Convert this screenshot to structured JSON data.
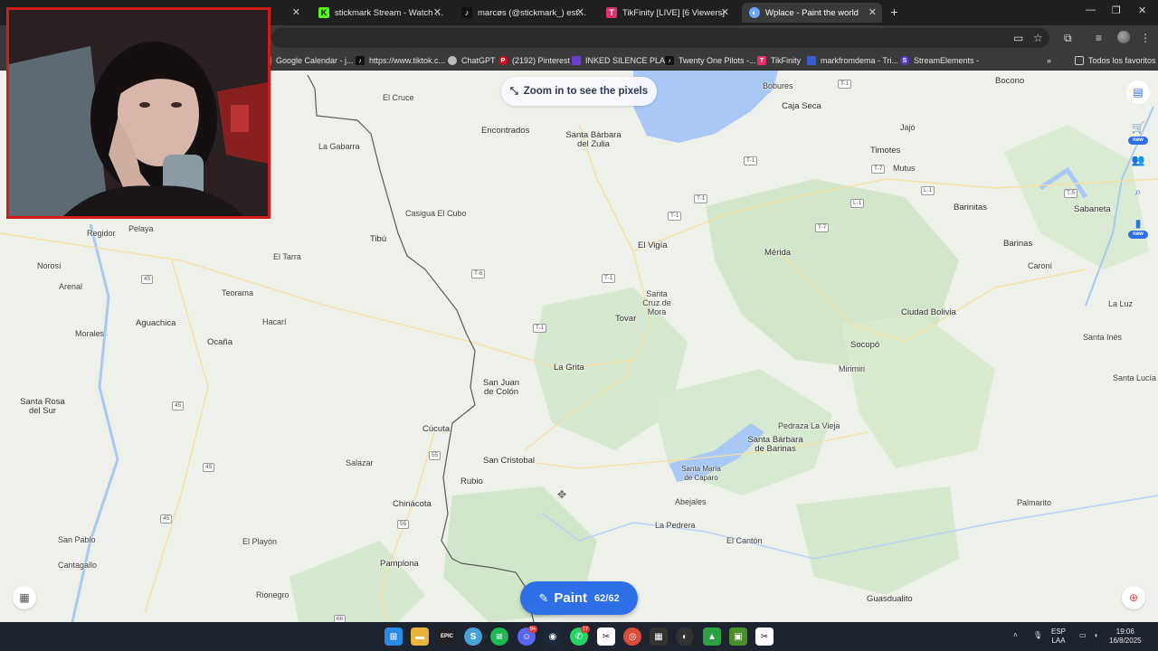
{
  "tabs": [
    {
      "label": "",
      "favicon_color": "#3a3a3a",
      "active": false
    },
    {
      "label": "stickmark Stream - Watch Live on Kick",
      "favicon_color": "#53fc18",
      "favicon_char": "K",
      "active": false
    },
    {
      "label": "marcøs (@stickmark_) está LIVE",
      "favicon_color": "#111111",
      "favicon_char": "♪",
      "active": false
    },
    {
      "label": "TikFinity [LIVE] [6 Viewers]",
      "favicon_color": "#e1306c",
      "favicon_char": "T",
      "active": false
    },
    {
      "label": "Wplace - Paint the world",
      "favicon_color": "#6aa7ff",
      "favicon_char": "◐",
      "active": true
    }
  ],
  "bookmarks": {
    "items": [
      {
        "label": "Google Calendar - j...",
        "icon_color": "#4285f4"
      },
      {
        "label": "https://www.tiktok.c...",
        "icon_color": "#111111"
      },
      {
        "label": "ChatGPT",
        "icon_color": "#bbbbbb"
      },
      {
        "label": "(2192) Pinterest",
        "icon_color": "#e60023"
      },
      {
        "label": "INKED SILENCE PLA...",
        "icon_color": "#6a3fd1"
      },
      {
        "label": "Twenty One Pilots -...",
        "icon_color": "#111111"
      },
      {
        "label": "TikFinity",
        "icon_color": "#e1306c"
      },
      {
        "label": "markfromdema - Tri...",
        "icon_color": "#3b5bd6"
      },
      {
        "label": "StreamElements -",
        "icon_color": "#5a36d6"
      }
    ],
    "all_label": "Todos los favoritos"
  },
  "map": {
    "zoom_hint": "Zoom in to see the pixels",
    "paint_label": "Paint",
    "paint_count": "62/62",
    "new_badge": "new",
    "places": [
      {
        "name": "Bobures"
      },
      {
        "name": "Caja Seca"
      },
      {
        "name": "Bocono"
      },
      {
        "name": "El Cruce"
      },
      {
        "name": "La Gabarra"
      },
      {
        "name": "Encontrados"
      },
      {
        "name": "Santa Bárbara del Zulia"
      },
      {
        "name": "Jajó"
      },
      {
        "name": "Timotes"
      },
      {
        "name": "Mutus"
      },
      {
        "name": "Barinitas"
      },
      {
        "name": "Sabaneta"
      },
      {
        "name": "Casigua El Cubo"
      },
      {
        "name": "Tibú"
      },
      {
        "name": "El Vigía"
      },
      {
        "name": "Mérida"
      },
      {
        "name": "Barinas"
      },
      {
        "name": "Caroní"
      },
      {
        "name": "Regidor"
      },
      {
        "name": "Pelaya"
      },
      {
        "name": "El Tarra"
      },
      {
        "name": "Norosí"
      },
      {
        "name": "Arenal"
      },
      {
        "name": "Teorama"
      },
      {
        "name": "Santa Cruz de Mora"
      },
      {
        "name": "La Luz"
      },
      {
        "name": "Aguachica"
      },
      {
        "name": "Hacarí"
      },
      {
        "name": "Tovar"
      },
      {
        "name": "Ciudad Bolivia"
      },
      {
        "name": "Morales"
      },
      {
        "name": "Ocaña"
      },
      {
        "name": "Santa Inés"
      },
      {
        "name": "Socopó"
      },
      {
        "name": "La Grita"
      },
      {
        "name": "Mirimiri"
      },
      {
        "name": "Santa Lucía"
      },
      {
        "name": "San Juan de Colón"
      },
      {
        "name": "Santa Rosa del Sur"
      },
      {
        "name": "Pedraza La Vieja"
      },
      {
        "name": "Cúcuta"
      },
      {
        "name": "Santa Bárbara de Barinas"
      },
      {
        "name": "Salazar"
      },
      {
        "name": "San Cristobal"
      },
      {
        "name": "Santa María de Caparo"
      },
      {
        "name": "Rubio"
      },
      {
        "name": "Abejales"
      },
      {
        "name": "Palmarito"
      },
      {
        "name": "Chinácota"
      },
      {
        "name": "La Pedrera"
      },
      {
        "name": "San Pablo"
      },
      {
        "name": "El Playón"
      },
      {
        "name": "El Cantón"
      },
      {
        "name": "Cantagallo"
      },
      {
        "name": "Pamplona"
      },
      {
        "name": "Rionegro"
      },
      {
        "name": "Guasdualito"
      }
    ],
    "road_shields": [
      "T-1",
      "T-1",
      "T-1",
      "T-1",
      "T-7",
      "T-7",
      "L-1",
      "L-1",
      "T-5",
      "T-6",
      "T-1",
      "T-1",
      "45",
      "45",
      "45",
      "45",
      "55",
      "55",
      "66"
    ]
  },
  "taskbar": {
    "lang_top": "ESP",
    "lang_bottom": "LAA",
    "time": "19:06",
    "date": "16/8/2025",
    "discord_badge": "9+",
    "whatsapp_badge": "17"
  }
}
